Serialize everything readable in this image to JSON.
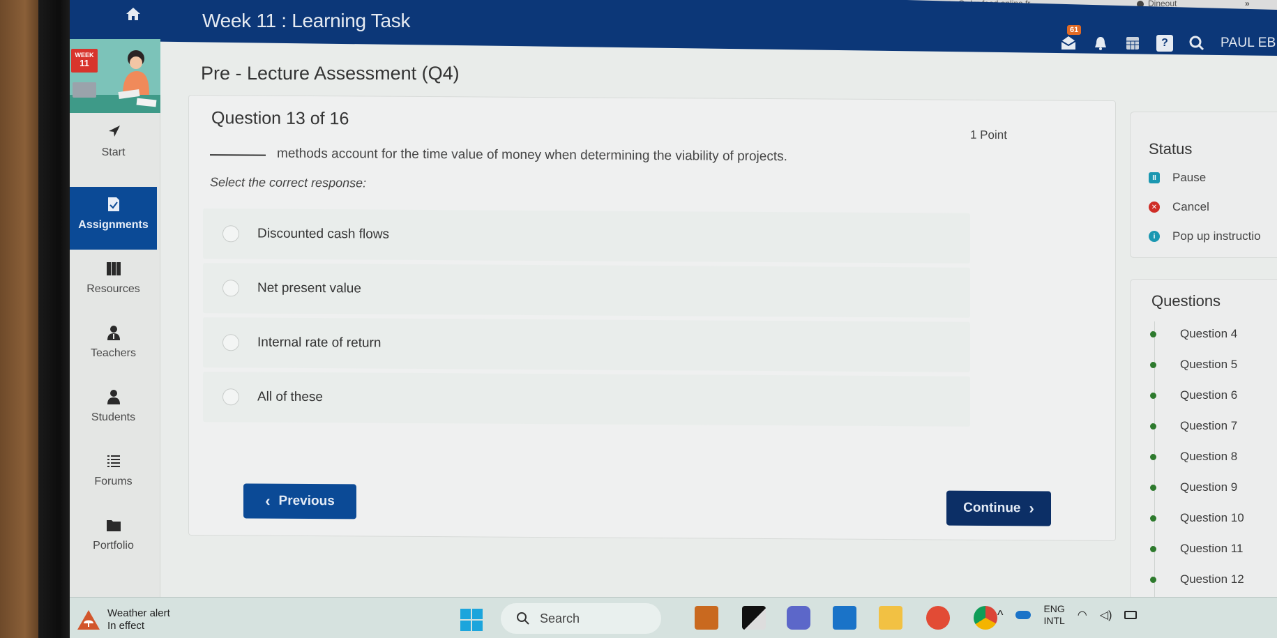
{
  "browser": {
    "bookmarks": [
      {
        "label": "Order food online fr...",
        "icon": "map-pin-icon"
      },
      {
        "label": "Dineout",
        "icon": "globe-icon"
      }
    ],
    "overflow_label": "»"
  },
  "header": {
    "home_icon": "home-icon",
    "course_title": "Week 11 : Learning Task",
    "mail_badge": "61",
    "icons": [
      "mail-icon",
      "bell-icon",
      "calendar-icon",
      "help-icon",
      "search-icon"
    ],
    "user_name": "PAUL EBENE"
  },
  "sidebar": {
    "week_tag_label": "WEEK",
    "week_tag_number": "11",
    "items": [
      {
        "label": "Start",
        "icon": "navigation-arrow-icon",
        "active": false
      },
      {
        "label": "Assignments",
        "icon": "assignment-check-icon",
        "active": true
      },
      {
        "label": "Resources",
        "icon": "books-icon",
        "active": false
      },
      {
        "label": "Teachers",
        "icon": "teacher-icon",
        "active": false
      },
      {
        "label": "Students",
        "icon": "student-icon",
        "active": false
      },
      {
        "label": "Forums",
        "icon": "list-icon",
        "active": false
      },
      {
        "label": "Portfolio",
        "icon": "folder-icon",
        "active": false
      }
    ]
  },
  "page": {
    "title": "Pre - Lecture Assessment (Q4)"
  },
  "question": {
    "counter": "Question 13 of 16",
    "points": "1 Point",
    "text": "methods account for the time value of money when determining the viability of projects.",
    "instruction": "Select the correct response:",
    "options": [
      {
        "label": "Discounted cash flows",
        "selected": false
      },
      {
        "label": "Net present value",
        "selected": false
      },
      {
        "label": "Internal rate of return",
        "selected": false
      },
      {
        "label": "All of these",
        "selected": false
      }
    ],
    "previous_label": "Previous",
    "continue_label": "Continue"
  },
  "status_panel": {
    "title": "Status",
    "actions": [
      {
        "label": "Pause",
        "icon": "pause-icon",
        "color": "#1a97b1"
      },
      {
        "label": "Cancel",
        "icon": "cancel-icon",
        "color": "#cf2d26"
      },
      {
        "label": "Pop up instructio",
        "icon": "info-icon",
        "color": "#1a97b1"
      }
    ]
  },
  "questions_panel": {
    "title": "Questions",
    "dot_color": "#2d7a2d",
    "items": [
      "Question 4",
      "Question 5",
      "Question 6",
      "Question 7",
      "Question 8",
      "Question 9",
      "Question 10",
      "Question 11",
      "Question 12"
    ]
  },
  "taskbar": {
    "weather_title": "Weather alert",
    "weather_sub": "In effect",
    "search_label": "Search",
    "apps": [
      "briefcase-icon",
      "terminal-icon",
      "teams-icon",
      "outlook-icon",
      "file-explorer-icon",
      "wps-office-icon",
      "chrome-icon"
    ],
    "lang_top": "ENG",
    "lang_bottom": "INTL",
    "tray_icons": [
      "chevron-up-icon",
      "onedrive-icon",
      "wifi-icon",
      "volume-icon",
      "battery-icon"
    ]
  }
}
